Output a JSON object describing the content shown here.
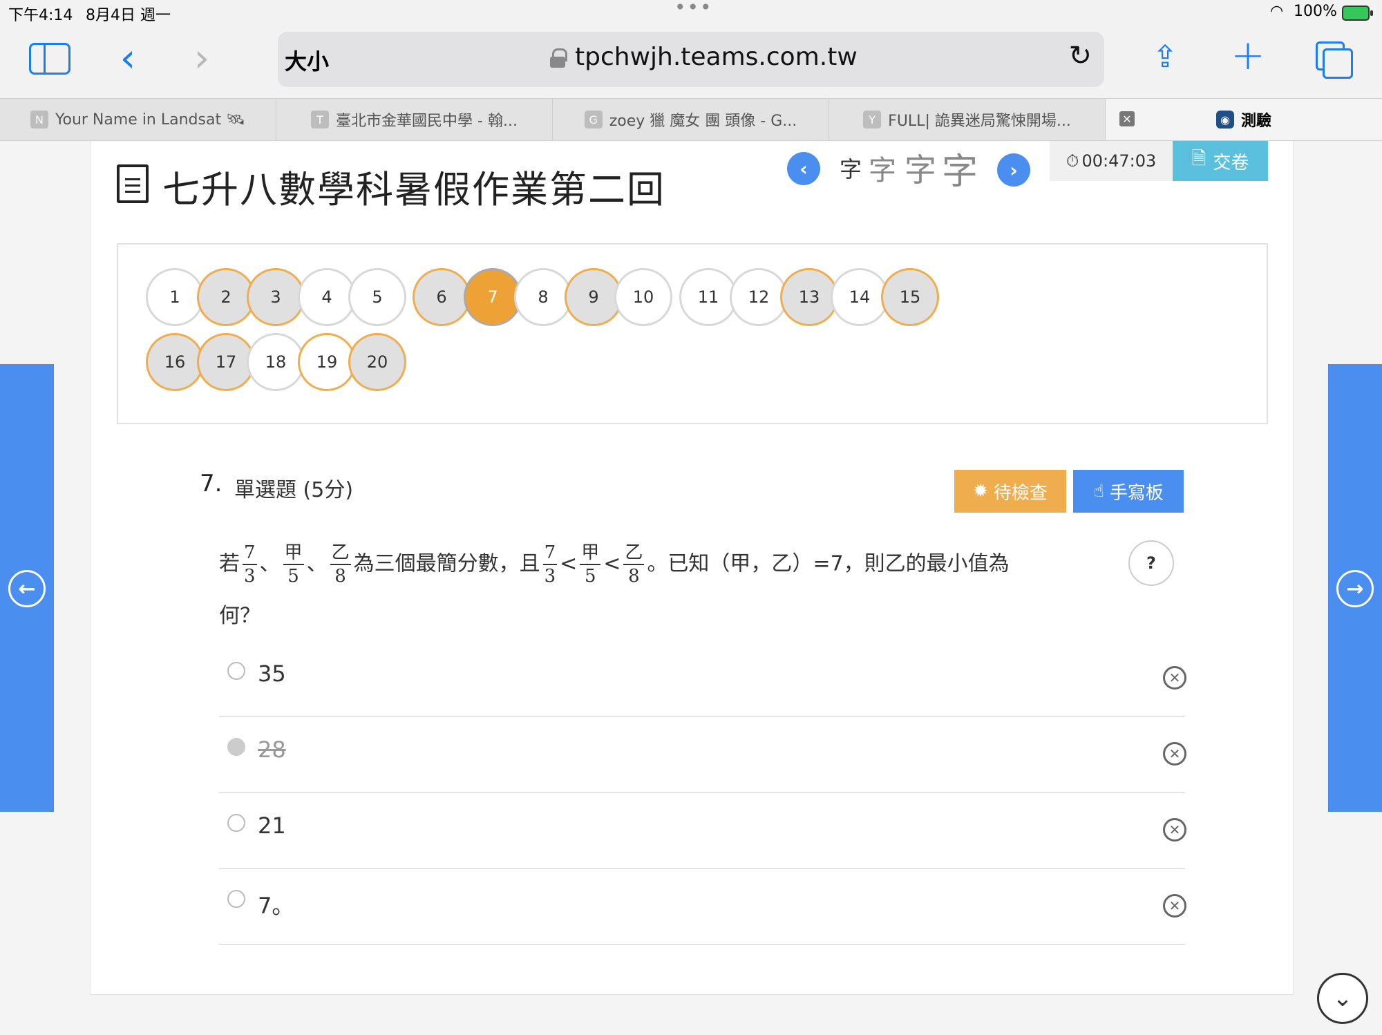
{
  "status_bar": {
    "time": "下午4:14",
    "date": "8月4日 週一",
    "battery": "100%"
  },
  "browser": {
    "text_size_label": "大小",
    "url": "tpchwjh.teams.com.tw",
    "tabs": [
      {
        "favicon": "N",
        "title": "Your Name in Landsat 🛰"
      },
      {
        "favicon": "T",
        "title": "臺北市金華國民中學 - 翰..."
      },
      {
        "favicon": "G",
        "title": "zoey 獵 魔女 團 頭像 - G..."
      },
      {
        "favicon": "Y",
        "title": "FULL| 詭異迷局驚悚開場..."
      },
      {
        "favicon": "",
        "title": "測驗",
        "active": true
      }
    ],
    "accent_color": "#1a7ef2"
  },
  "header": {
    "title": "七升八數學科暑假作業第二回",
    "font_size_glyph": "字",
    "timer": "00:47:03",
    "submit_label": "交卷"
  },
  "question_nav": [
    {
      "n": "1",
      "state": "unanswered"
    },
    {
      "n": "2",
      "state": "answered"
    },
    {
      "n": "3",
      "state": "answered"
    },
    {
      "n": "4",
      "state": "unanswered"
    },
    {
      "n": "5",
      "state": "unanswered"
    },
    {
      "n": "6",
      "state": "answered"
    },
    {
      "n": "7",
      "state": "current"
    },
    {
      "n": "8",
      "state": "unanswered"
    },
    {
      "n": "9",
      "state": "answered"
    },
    {
      "n": "10",
      "state": "unanswered"
    },
    {
      "n": "11",
      "state": "unanswered"
    },
    {
      "n": "12",
      "state": "unanswered"
    },
    {
      "n": "13",
      "state": "answered"
    },
    {
      "n": "14",
      "state": "unanswered"
    },
    {
      "n": "15",
      "state": "answered"
    },
    {
      "n": "16",
      "state": "answered"
    },
    {
      "n": "17",
      "state": "answered"
    },
    {
      "n": "18",
      "state": "unanswered"
    },
    {
      "n": "19",
      "state": "flagged"
    },
    {
      "n": "20",
      "state": "answered"
    }
  ],
  "question": {
    "number": "7.",
    "type": "單選題 (5分)",
    "review_label": "待檢查",
    "handwrite_label": "手寫板",
    "help_label": "?",
    "stem": {
      "prefix": "若",
      "f1": {
        "num": "7",
        "den": "3"
      },
      "sep1": "、",
      "f2": {
        "num": "甲",
        "den": "5"
      },
      "sep2": "、",
      "f3": {
        "num": "乙",
        "den": "8"
      },
      "mid": "為三個最簡分數，且",
      "lt1": "<",
      "lt2": "<",
      "suffix": "。已知（甲，乙）=7，則乙的最小值為",
      "line2": "何？"
    },
    "options": [
      {
        "text": "35",
        "struck": false
      },
      {
        "text": "28",
        "struck": true
      },
      {
        "text": "21",
        "struck": false
      },
      {
        "text": "7。",
        "struck": false
      }
    ]
  }
}
